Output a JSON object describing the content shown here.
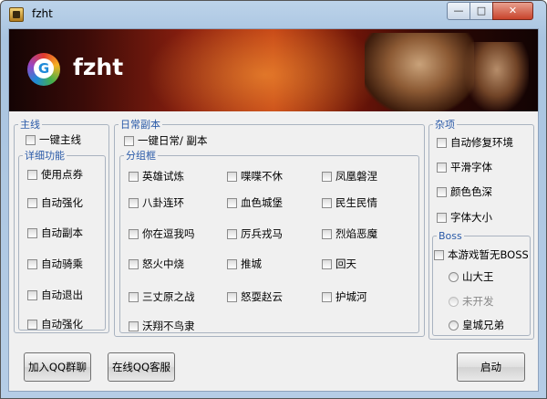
{
  "window": {
    "title": "fzht",
    "min_glyph": "—",
    "max_glyph": "□",
    "close_glyph": "✕"
  },
  "banner": {
    "logo_text": "fzht"
  },
  "main": {
    "legend": "主线",
    "one_click": "一键主线",
    "detail": {
      "legend": "详细功能",
      "items": [
        "使用点券",
        "自动强化",
        "自动副本",
        "自动骑乘",
        "自动退出",
        "自动强化"
      ]
    }
  },
  "daily": {
    "legend": "日常副本",
    "one_click": "一键日常/ 副本",
    "group": {
      "legend": "分组框",
      "col1": [
        "英雄试炼",
        "八卦连环",
        "你在逗我吗",
        "怒火中烧",
        "三丈原之战",
        "沃翔不鸟隶"
      ],
      "col2": [
        "喋喋不休",
        "血色城堡",
        "厉兵戎马",
        "推城",
        "怒耍赵云"
      ],
      "col3": [
        "凤凰磐涅",
        "民生民情",
        "烈焰恶魔",
        "回天",
        "护城河"
      ]
    }
  },
  "misc": {
    "legend": "杂项",
    "items": [
      "自动修复环境",
      "平滑字体",
      "颜色色深",
      "字体大小"
    ],
    "boss": {
      "legend": "Boss",
      "checkbox": "本游戏暂无BOSS",
      "radios": [
        {
          "label": "山大王",
          "disabled": false
        },
        {
          "label": "未开发",
          "disabled": true
        },
        {
          "label": "皇城兄弟",
          "disabled": false
        }
      ]
    }
  },
  "buttons": {
    "qq_group": "加入QQ群聊",
    "qq_service": "在线QQ客服",
    "start": "启动"
  }
}
